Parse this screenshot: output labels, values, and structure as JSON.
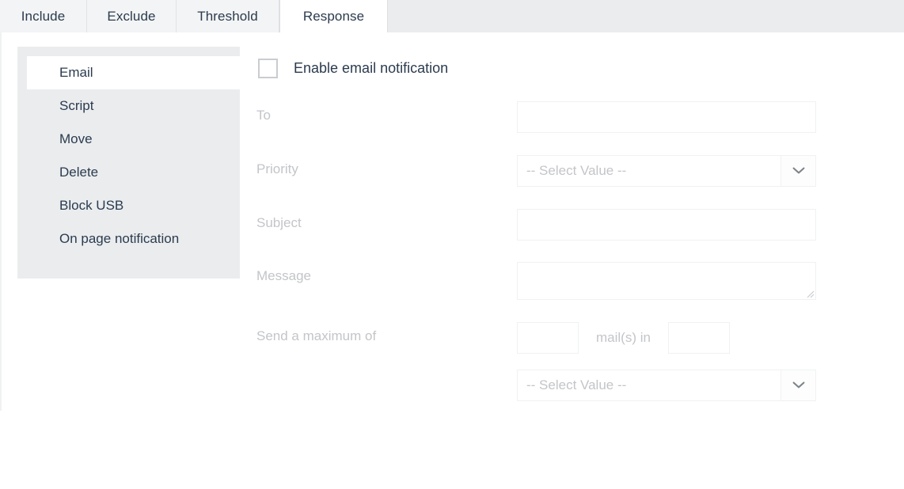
{
  "tabs": [
    {
      "label": "Include",
      "active": false
    },
    {
      "label": "Exclude",
      "active": false
    },
    {
      "label": "Threshold",
      "active": false
    },
    {
      "label": "Response",
      "active": true
    }
  ],
  "sidebar": {
    "items": [
      {
        "label": "Email"
      },
      {
        "label": "Script"
      },
      {
        "label": "Move"
      },
      {
        "label": "Delete"
      },
      {
        "label": "Block USB"
      },
      {
        "label": "On page notification"
      }
    ]
  },
  "form": {
    "enable_checkbox_label": "Enable email notification",
    "enable_checked": false,
    "to": {
      "label": "To",
      "value": "",
      "placeholder": ""
    },
    "priority": {
      "label": "Priority",
      "selected": "-- Select Value --"
    },
    "subject": {
      "label": "Subject",
      "value": "",
      "placeholder": ""
    },
    "message": {
      "label": "Message",
      "value": "",
      "placeholder": ""
    },
    "max_mails": {
      "label": "Send a maximum of",
      "count_value": "",
      "middle_text": "mail(s) in",
      "period_value": "",
      "period_unit_selected": "-- Select Value --"
    }
  },
  "icons": {
    "chevron_down": "chevron-down-icon",
    "resize_grip": "resize-grip-icon"
  },
  "colors": {
    "tab_bar_bg": "#ebecee",
    "tab_inactive_bg": "#f3f4f5",
    "tab_active_bg": "#ffffff",
    "tab_text": "#2b3b4e",
    "sidebar_bg": "#eaecee",
    "sidebar_active_bg": "#ffffff",
    "disabled_label": "#c3c5c9",
    "field_border": "#f0f1f2",
    "checkbox_border": "#c9ccd0"
  }
}
